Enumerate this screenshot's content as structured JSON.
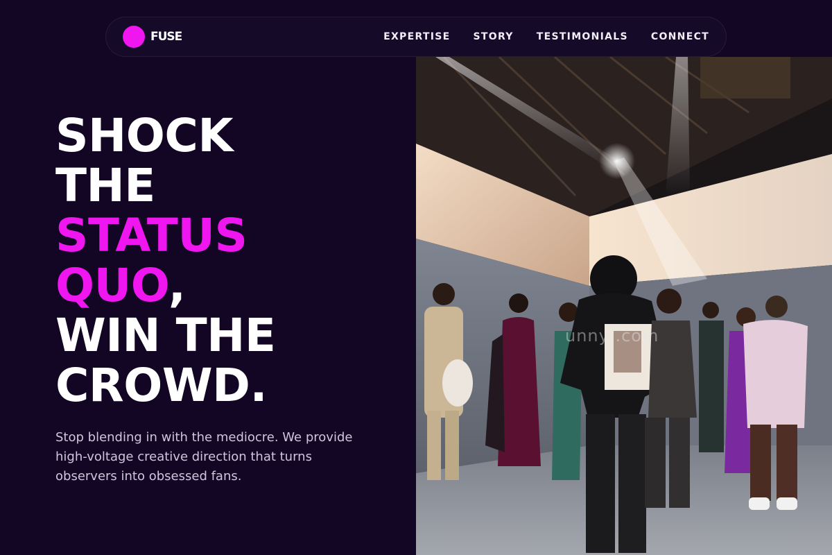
{
  "nav": {
    "brand": "FUSE",
    "links": [
      "EXPERTISE",
      "STORY",
      "TESTIMONIALS",
      "CONNECT"
    ]
  },
  "hero": {
    "line1": "SHOCK",
    "line2": "THE",
    "line3_accent": "STATUS",
    "line4_accent": "QUO",
    "line4_tail": ",",
    "line5": "WIN THE",
    "line6": "CROWD.",
    "subtext": "Stop blending in with the mediocre. We provide high-voltage creative direction that turns observers into obsessed fans."
  },
  "photo": {
    "watermark": "unny   .com"
  },
  "colors": {
    "background": "#130625",
    "accent": "#ef16ef",
    "text": "#ffffff",
    "subtext": "#cfc6dd"
  }
}
